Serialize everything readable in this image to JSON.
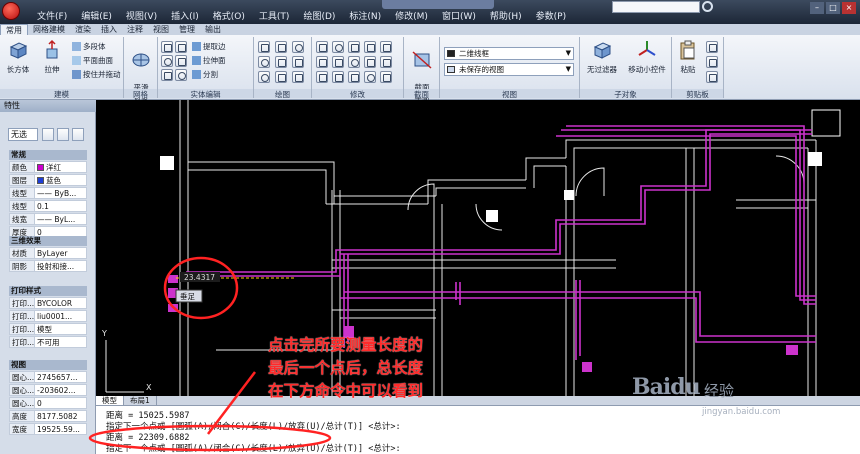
{
  "titlebar": {
    "title": "",
    "menu": [
      "文件(F)",
      "编辑(E)",
      "视图(V)",
      "插入(I)",
      "格式(O)",
      "工具(T)",
      "绘图(D)",
      "标注(N)",
      "修改(M)",
      "窗口(W)",
      "帮助(H)",
      "参数(P)"
    ]
  },
  "ribbon": {
    "tabs": [
      "常用",
      "网格建模",
      "渲染",
      "插入",
      "注释",
      "视图",
      "管理",
      "输出"
    ],
    "panels": {
      "modeling": {
        "title": "建模",
        "box": "长方体",
        "extrude": "拉伸",
        "polysolid": "多段体",
        "planar": "平面曲面",
        "presspull": "按住并拖动"
      },
      "mesh": {
        "title": "网格",
        "smooth": "平滑\n对象"
      },
      "solid_edit": {
        "title": "实体编辑",
        "extract": "提取边",
        "extrude_face": "拉伸面",
        "separate": "分割"
      },
      "draw": {
        "title": "绘图"
      },
      "modify": {
        "title": "修改"
      },
      "section": {
        "title": "截面",
        "plane": "截面\n平面"
      },
      "view": {
        "title": "视图",
        "visual_style": "二维线框",
        "saved_view": "未保存的视图"
      },
      "subobject": {
        "title": "子对象",
        "no_filter": "无过滤器",
        "gizmo": "移动小控件"
      },
      "clipboard": {
        "title": "剪贴板",
        "paste": "粘贴"
      }
    }
  },
  "properties": {
    "title": "特性",
    "selection": "无选",
    "sections": {
      "general": "常规",
      "3d": "三维效果",
      "plot": "打印样式",
      "view": "视图"
    },
    "general_rows": [
      {
        "k": "颜色",
        "v": "洋红",
        "swatch": "#cc00cc"
      },
      {
        "k": "图层",
        "v": "蓝色",
        "swatch": "#1f3fd6"
      },
      {
        "k": "线型",
        "v": "—— ByB..."
      },
      {
        "k": "线型",
        "v": "0.1"
      },
      {
        "k": "线宽",
        "v": "—— ByL..."
      },
      {
        "k": "厚度",
        "v": "0"
      }
    ],
    "3d_rows": [
      {
        "k": "材质",
        "v": "ByLayer"
      },
      {
        "k": "阴影",
        "v": "投射和接..."
      }
    ],
    "plot_rows": [
      {
        "k": "打印...",
        "v": "BYCOLOR"
      },
      {
        "k": "打印...",
        "v": "liu0001..."
      },
      {
        "k": "打印...",
        "v": "模型"
      },
      {
        "k": "打印...",
        "v": "不可用"
      }
    ],
    "view_rows": [
      {
        "k": "圆心...",
        "v": "2745657..."
      },
      {
        "k": "圆心...",
        "v": "-203602..."
      },
      {
        "k": "圆心...",
        "v": "0"
      },
      {
        "k": "高度",
        "v": "8177.5082"
      },
      {
        "k": "宽度",
        "v": "19525.59..."
      }
    ]
  },
  "canvas": {
    "measure_value": "23.4317",
    "tooltip": "垂足",
    "ucs_x": "X",
    "ucs_y": "Y"
  },
  "layout_tabs": [
    "模型",
    "布局1"
  ],
  "command_lines": [
    "距离 = 15025.5987",
    "指定下一个点或 [圆弧(A)/闭合(C)/长度(L)/放弃(U)/总计(T)] <总计>:",
    "距离 = 22309.6882",
    "指定下一个点或 [圆弧(A)/闭合(C)/长度(L)/放弃(U)/总计(T)] <总计>:"
  ],
  "annotation": [
    "点击完所要测量长度的",
    "最后一个点后，总长度",
    "在下方命令中可以看到"
  ],
  "watermark": {
    "logo": "Baidu",
    "sub": "经验",
    "url": "jingyan.baidu.com"
  },
  "colors": {
    "accent": "#cc33cc",
    "annotation": "#ff2a2a",
    "canvas": "#000000"
  }
}
